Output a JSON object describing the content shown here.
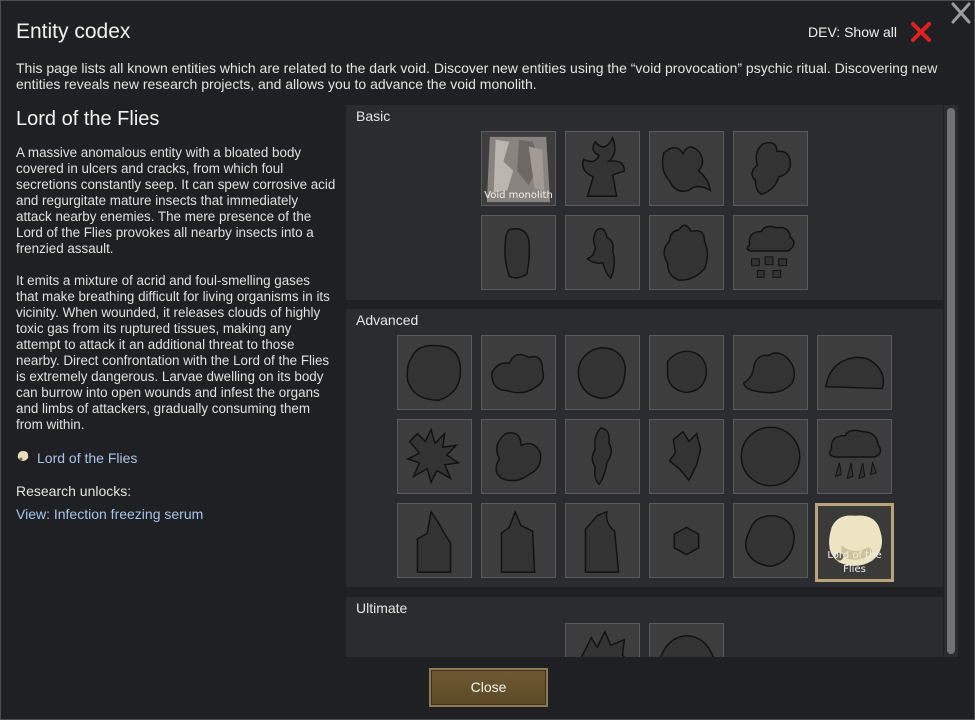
{
  "window": {
    "title": "Entity codex",
    "dev_toggle_label": "DEV: Show all",
    "intro": "This page lists all known entities which are related to the dark void. Discover new entities using the “void provocation” psychic ritual. Discovering new entities reveals new research projects, and allows you to advance the void monolith."
  },
  "selected_entity": {
    "name": "Lord of the Flies",
    "description_1": "A massive anomalous entity with a bloated body covered in ulcers and cracks, from which foul secretions constantly seep. It can spew corrosive acid and regurgitate mature insects that immediately attack nearby enemies. The mere presence of the Lord of the Flies provokes all nearby insects into a frenzied assault.",
    "description_2": "It emits a mixture of acrid and foul-smelling gases that make breathing difficult for living organisms in its vicinity. When wounded, it releases clouds of highly toxic gas from its ruptured tissues, making any attempt to attack it an additional threat to those nearby. Direct confrontation with the Lord of the Flies is extremely dangerous. Larvae dwelling on its body can burrow into open wounds and infest the organs and limbs of attackers, gradually consuming them from within.",
    "link_label": "Lord of the Flies",
    "research_label": "Research unlocks:",
    "research_link": "View: Infection freezing serum"
  },
  "sections": {
    "basic": "Basic",
    "advanced": "Advanced",
    "ultimate": "Ultimate"
  },
  "cells": {
    "void_monolith": "Void monolith",
    "lord_of_the_flies": "Lord of the Flies"
  },
  "buttons": {
    "close": "Close"
  },
  "colors": {
    "accent": "#b7a37c",
    "link": "#a9c4ea",
    "dev_x": "#e02020"
  }
}
